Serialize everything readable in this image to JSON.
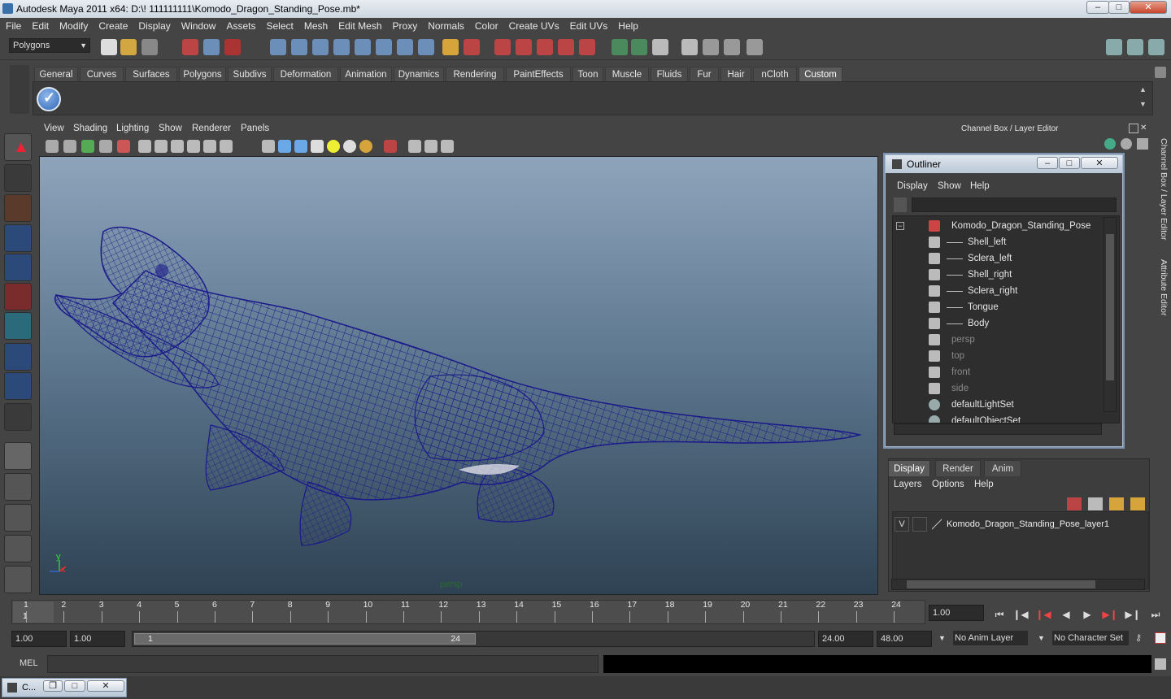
{
  "window": {
    "title": "Autodesk Maya 2011 x64: D:\\! 111111111\\Komodo_Dragon_Standing_Pose.mb*"
  },
  "menubar": [
    "File",
    "Edit",
    "Modify",
    "Create",
    "Display",
    "Window",
    "Assets",
    "Select",
    "Mesh",
    "Edit Mesh",
    "Proxy",
    "Normals",
    "Color",
    "Create UVs",
    "Edit UVs",
    "Help"
  ],
  "statusline": {
    "mode": "Polygons"
  },
  "shelf": {
    "tabs": [
      "General",
      "Curves",
      "Surfaces",
      "Polygons",
      "Subdivs",
      "Deformation",
      "Animation",
      "Dynamics",
      "Rendering",
      "PaintEffects",
      "Toon",
      "Muscle",
      "Fluids",
      "Fur",
      "Hair",
      "nCloth",
      "Custom"
    ],
    "active": "Custom"
  },
  "viewport": {
    "menus": [
      "View",
      "Shading",
      "Lighting",
      "Show",
      "Renderer",
      "Panels"
    ],
    "camera_label": "persp",
    "axis_y": "y",
    "axis_x": "x",
    "wire_color": "#1a1a8a"
  },
  "right_panel": {
    "title": "Channel Box / Layer Editor",
    "vtab1": "Channel Box / Layer Editor",
    "vtab2": "Attribute Editor"
  },
  "outliner": {
    "title": "Outliner",
    "menus": [
      "Display",
      "Show",
      "Help"
    ],
    "items": [
      {
        "label": "Komodo_Dragon_Standing_Pose",
        "indent": 0,
        "dim": false
      },
      {
        "label": "Shell_left",
        "indent": 1,
        "dim": false
      },
      {
        "label": "Sclera_left",
        "indent": 1,
        "dim": false
      },
      {
        "label": "Shell_right",
        "indent": 1,
        "dim": false
      },
      {
        "label": "Sclera_right",
        "indent": 1,
        "dim": false
      },
      {
        "label": "Tongue",
        "indent": 1,
        "dim": false
      },
      {
        "label": "Body",
        "indent": 1,
        "dim": false
      },
      {
        "label": "persp",
        "indent": 0,
        "dim": true
      },
      {
        "label": "top",
        "indent": 0,
        "dim": true
      },
      {
        "label": "front",
        "indent": 0,
        "dim": true
      },
      {
        "label": "side",
        "indent": 0,
        "dim": true
      },
      {
        "label": "defaultLightSet",
        "indent": 0,
        "dim": false
      },
      {
        "label": "defaultObjectSet",
        "indent": 0,
        "dim": false
      }
    ]
  },
  "layer_editor": {
    "tabs": [
      "Display",
      "Render",
      "Anim"
    ],
    "active": "Display",
    "menus": [
      "Layers",
      "Options",
      "Help"
    ],
    "layers": [
      {
        "visible": "V",
        "name": "Komodo_Dragon_Standing_Pose_layer1"
      }
    ]
  },
  "timeline": {
    "ticks": [
      "1",
      "2",
      "3",
      "4",
      "5",
      "6",
      "7",
      "8",
      "9",
      "10",
      "11",
      "12",
      "13",
      "14",
      "15",
      "16",
      "17",
      "18",
      "19",
      "20",
      "21",
      "22",
      "23",
      "24"
    ],
    "current_frame_marker": "1",
    "current_time": "1.00"
  },
  "range": {
    "start_time": "1.00",
    "playback_start": "1.00",
    "slider_start": "1",
    "slider_end": "24",
    "playback_end": "24.00",
    "end_time": "48.00",
    "anim_layer": "No Anim Layer",
    "character_set": "No Character Set"
  },
  "cmdline": {
    "label": "MEL"
  },
  "taskbar": {
    "label": "C..."
  }
}
